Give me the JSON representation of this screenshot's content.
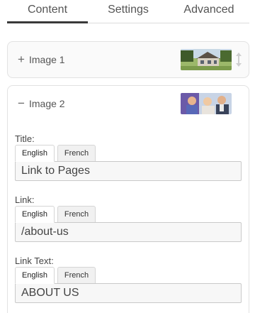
{
  "tabs": {
    "content": "Content",
    "settings": "Settings",
    "advanced": "Advanced"
  },
  "items": [
    {
      "toggle": "+",
      "title": "Image 1"
    },
    {
      "toggle": "−",
      "title": "Image 2"
    }
  ],
  "fields": {
    "title": {
      "label": "Title:",
      "en": "English",
      "fr": "French",
      "value": "Link to Pages"
    },
    "link": {
      "label": "Link:",
      "en": "English",
      "fr": "French",
      "value": "/about-us"
    },
    "link_text": {
      "label": "Link Text:",
      "en": "English",
      "fr": "French",
      "value": "ABOUT US"
    }
  },
  "colors": {
    "active_tab_underline": "#3a3a3a",
    "panel_border": "#e2e2e2",
    "input_background": "#f7f7f7"
  },
  "icons": {
    "expand": "plus-icon",
    "collapse": "minus-icon",
    "drag": "drag-handle-icon"
  }
}
